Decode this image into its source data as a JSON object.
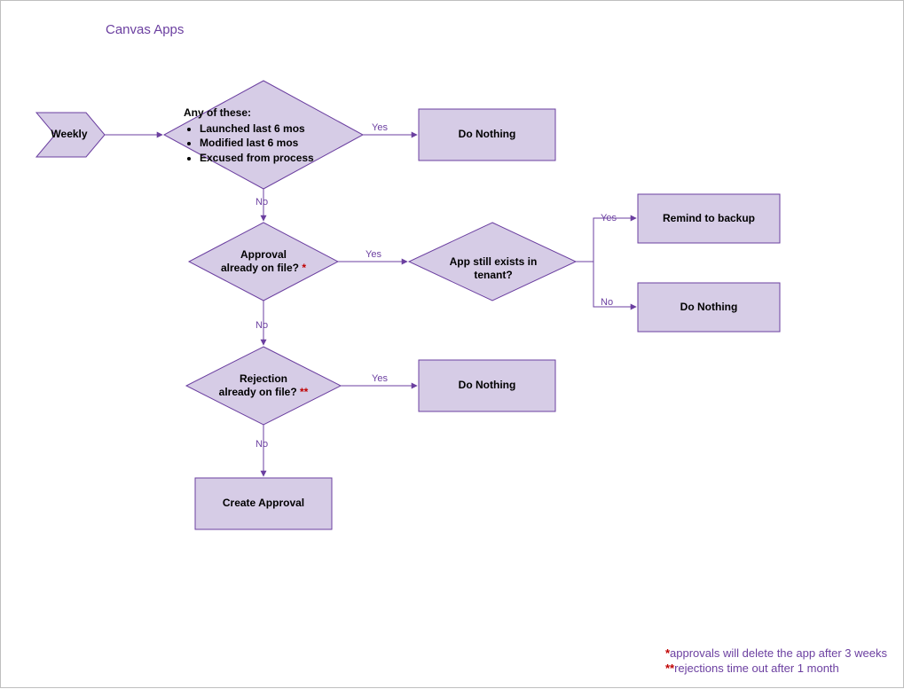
{
  "title": "Canvas Apps",
  "start": {
    "label": "Weekly"
  },
  "decision1": {
    "head": "Any of these:",
    "items": [
      "Launched last 6 mos",
      "Modified last 6 mos",
      "Excused from process"
    ],
    "yes": "Yes",
    "no": "No"
  },
  "decision2": {
    "label_line1": "Approval",
    "label_line2_prefix": "already on file? ",
    "star": "*",
    "yes": "Yes",
    "no": "No"
  },
  "decision3": {
    "label": "App still exists in tenant?",
    "yes": "Yes",
    "no": "No"
  },
  "decision4": {
    "label_line1": "Rejection",
    "label_line2_prefix": "already on file? ",
    "star": "**",
    "yes": "Yes",
    "no": "No"
  },
  "process": {
    "do_nothing_1": "Do Nothing",
    "remind_backup": "Remind to backup",
    "do_nothing_2": "Do Nothing",
    "do_nothing_3": "Do Nothing",
    "create_approval": "Create Approval"
  },
  "footnotes": {
    "star1": "*",
    "line1": "approvals will delete the app after 3 weeks",
    "star2": "**",
    "line2": "rejections time out after 1 month"
  }
}
